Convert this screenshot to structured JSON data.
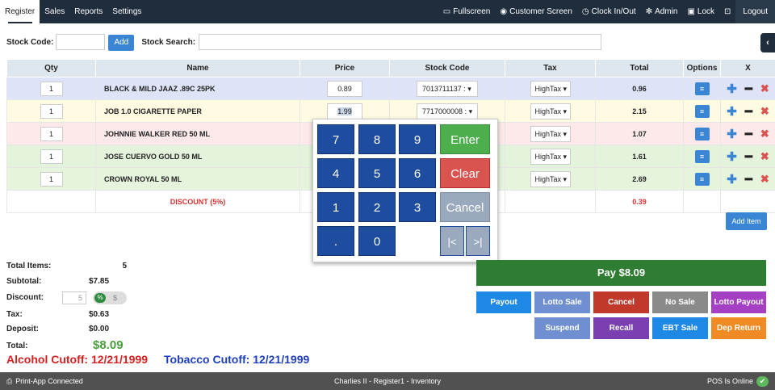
{
  "nav": {
    "tabs": [
      "Register",
      "Sales",
      "Reports",
      "Settings"
    ],
    "right": [
      "Fullscreen",
      "Customer Screen",
      "Clock In/Out",
      "Admin",
      "Lock"
    ],
    "logout": "Logout"
  },
  "stock": {
    "code_label": "Stock Code:",
    "add_label": "Add",
    "search_label": "Stock Search:"
  },
  "table": {
    "headers": [
      "Qty",
      "Name",
      "Price",
      "Stock Code",
      "Tax",
      "Total",
      "Options",
      "X"
    ],
    "rows": [
      {
        "qty": "1",
        "name": "BLACK & MILD JAAZ .89C 25PK",
        "price": "0.89",
        "stock_code": "7013711137 :",
        "tax": "HighTax",
        "total": "0.96"
      },
      {
        "qty": "1",
        "name": "JOB 1.0 CIGARETTE PAPER",
        "price": "1.99",
        "stock_code": "7717000008 :",
        "tax": "HighTax",
        "total": "2.15"
      },
      {
        "qty": "1",
        "name": "JOHNNIE WALKER RED 50 ML",
        "price": "",
        "stock_code": "",
        "tax": "HighTax",
        "total": "1.07"
      },
      {
        "qty": "1",
        "name": "JOSE CUERVO GOLD 50 ML",
        "price": "",
        "stock_code": "",
        "tax": "HighTax",
        "total": "1.61"
      },
      {
        "qty": "1",
        "name": "CROWN ROYAL 50 ML",
        "price": "",
        "stock_code": "",
        "tax": "HighTax",
        "total": "2.69"
      }
    ],
    "discount_label": "DISCOUNT (5%)",
    "discount_value": "0.39"
  },
  "add_item": "Add Item",
  "keypad": {
    "keys": [
      "7",
      "8",
      "9",
      "4",
      "5",
      "6",
      "1",
      "2",
      "3",
      ".",
      "0"
    ],
    "enter": "Enter",
    "clear": "Clear",
    "cancel": "Cancel",
    "first": "|<",
    "last": ">|"
  },
  "totals": {
    "items_label": "Total Items:",
    "items": "5",
    "subtotal_label": "Subtotal:",
    "subtotal": "$7.85",
    "discount_label": "Discount:",
    "discount_input": "5",
    "pct": "%",
    "dol": "$",
    "tax_label": "Tax:",
    "tax": "$0.63",
    "deposit_label": "Deposit:",
    "deposit": "$0.00",
    "total_label": "Total:",
    "total": "$8.09"
  },
  "cutoff": {
    "alcohol": "Alcohol Cutoff: 12/21/1999",
    "tobacco": "Tobacco Cutoff: 12/21/1999"
  },
  "actions": {
    "pay": "Pay $8.09",
    "row1": [
      "Payout",
      "Lotto Sale",
      "Cancel",
      "No Sale",
      "Lotto Payout"
    ],
    "row2": [
      "Suspend",
      "Recall",
      "EBT Sale",
      "Dep Return"
    ]
  },
  "footer": {
    "left": "Print-App Connected",
    "middle": "Charlies II - Register1 - Inventory",
    "right": "POS Is Online"
  },
  "colors": {
    "nav_bg": "#1f2d3d",
    "pay": "#2e7d32",
    "payout": "#1e88e5",
    "lotto_sale": "#6f8fd0",
    "cancel": "#c0392b",
    "no_sale": "#8a8a8a",
    "lotto_payout": "#a53fc4",
    "suspend": "#6f8fd0",
    "recall": "#7a3fb0",
    "ebt_sale": "#1e88e5",
    "dep_return": "#f08a24"
  }
}
